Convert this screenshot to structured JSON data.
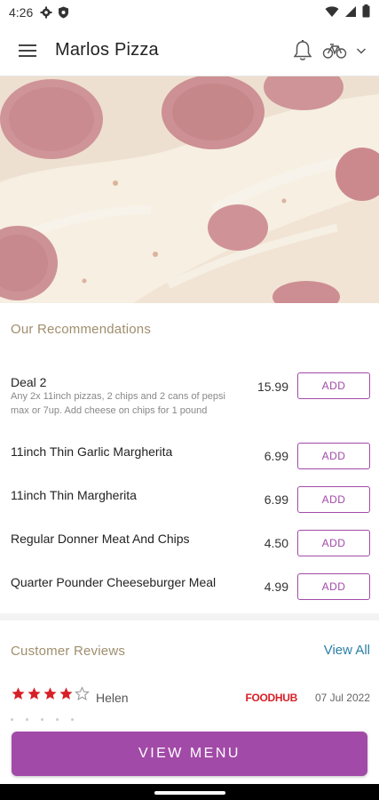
{
  "status_bar": {
    "time": "4:26",
    "icons": [
      "gear-icon",
      "shield-icon",
      "wifi-icon",
      "signal-icon",
      "battery-icon"
    ]
  },
  "app_bar": {
    "title": "Marlos Pizza",
    "icons": [
      "hamburger-menu-icon",
      "bell-icon",
      "bicycle-icon",
      "chevron-down-icon"
    ]
  },
  "hero": {
    "image": "pepperoni-pizza-photo"
  },
  "recommendations": {
    "title": "Our Recommendations",
    "add_label": "ADD",
    "items": [
      {
        "name": "Deal 2",
        "description": "Any 2x 11inch pizzas, 2 chips and 2 cans of pepsi max or 7up. Add cheese on chips for 1 pound",
        "price": "15.99"
      },
      {
        "name": "11inch Thin Garlic Margherita",
        "description": "",
        "price": "6.99"
      },
      {
        "name": "11inch Thin Margherita",
        "description": "",
        "price": "6.99"
      },
      {
        "name": "Regular Donner Meat And Chips",
        "description": "",
        "price": "4.50"
      },
      {
        "name": "Quarter Pounder Cheeseburger Meal",
        "description": "",
        "price": "4.99"
      }
    ]
  },
  "reviews": {
    "title": "Customer Reviews",
    "view_all": "View All",
    "items": [
      {
        "rating": 4,
        "max_rating": 5,
        "reviewer": "Helen",
        "source": "FOODHUB",
        "date": "07 Jul 2022"
      }
    ]
  },
  "bottom": {
    "view_menu": "VIEW MENU"
  },
  "colors": {
    "accent": "#a24aa8",
    "section_title": "#a08e6e",
    "link": "#2a7fa8",
    "star": "#d71f26",
    "foodhub": "#d71f26"
  }
}
